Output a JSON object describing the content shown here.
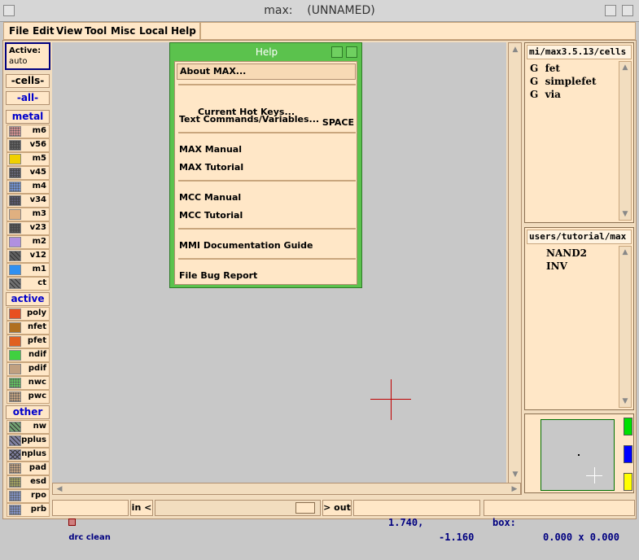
{
  "window": {
    "title": "max:    (UNNAMED)"
  },
  "menubar": {
    "items": [
      "File",
      "Edit",
      "View",
      "Tool",
      "Misc",
      "Local",
      "Help"
    ]
  },
  "active": {
    "label": "Active:",
    "value": "auto"
  },
  "sidebar": {
    "cells_label": "-cells-",
    "all_label": "-all-",
    "groups": [
      {
        "name": "metal",
        "layers": [
          {
            "name": "m6",
            "color": "#d09090",
            "pattern": "dots"
          },
          {
            "name": "v56",
            "color": "#808080",
            "pattern": "grid"
          },
          {
            "name": "m5",
            "color": "#f0d000",
            "pattern": "solid"
          },
          {
            "name": "v45",
            "color": "#8888aa",
            "pattern": "grid"
          },
          {
            "name": "m4",
            "color": "#7090d0",
            "pattern": "dots"
          },
          {
            "name": "v34",
            "color": "#7070a0",
            "pattern": "grid"
          },
          {
            "name": "m3",
            "color": "#e0b080",
            "pattern": "solid"
          },
          {
            "name": "v23",
            "color": "#707070",
            "pattern": "grid"
          },
          {
            "name": "m2",
            "color": "#b090e0",
            "pattern": "solid"
          },
          {
            "name": "v12",
            "color": "#606060",
            "pattern": "diag"
          },
          {
            "name": "m1",
            "color": "#3090f0",
            "pattern": "solid"
          },
          {
            "name": "ct",
            "color": "#707070",
            "pattern": "diag"
          }
        ]
      },
      {
        "name": "active",
        "layers": [
          {
            "name": "poly",
            "color": "#e85020",
            "pattern": "solid"
          },
          {
            "name": "nfet",
            "color": "#b07020",
            "pattern": "solid"
          },
          {
            "name": "pfet",
            "color": "#e06020",
            "pattern": "solid"
          },
          {
            "name": "ndif",
            "color": "#40d040",
            "pattern": "solid"
          },
          {
            "name": "pdif",
            "color": "#c0a080",
            "pattern": "solid"
          },
          {
            "name": "nwc",
            "color": "#60c060",
            "pattern": "dots"
          },
          {
            "name": "pwc",
            "color": "#c0a080",
            "pattern": "dots"
          }
        ]
      },
      {
        "name": "other",
        "layers": [
          {
            "name": "nw",
            "color": "#70a070",
            "pattern": "diag"
          },
          {
            "name": "pplus",
            "color": "#8080a0",
            "pattern": "diag"
          },
          {
            "name": "nplus",
            "color": "#8080a0",
            "pattern": "cross"
          },
          {
            "name": "pad",
            "color": "#c0a080",
            "pattern": "dots"
          },
          {
            "name": "esd",
            "color": "#a0a060",
            "pattern": "dots"
          },
          {
            "name": "rpo",
            "color": "#8090c0",
            "pattern": "dots"
          },
          {
            "name": "prb",
            "color": "#8090c0",
            "pattern": "dots"
          }
        ]
      }
    ]
  },
  "help_menu": {
    "title": "Help",
    "items": [
      {
        "label": "About MAX...",
        "shortcut": ""
      },
      {
        "label": "Current Hot Keys...",
        "shortcut": "SPACE"
      },
      {
        "label": "Text Commands/Variables...",
        "shortcut": ""
      },
      {
        "label": "MAX Manual",
        "shortcut": ""
      },
      {
        "label": "MAX Tutorial",
        "shortcut": ""
      },
      {
        "label": "MCC Manual",
        "shortcut": ""
      },
      {
        "label": "MCC Tutorial",
        "shortcut": ""
      },
      {
        "label": "MMI Documentation Guide",
        "shortcut": ""
      },
      {
        "label": "File Bug Report",
        "shortcut": ""
      }
    ]
  },
  "library_panel": {
    "path": "mi/max3.5.13/cells",
    "items": [
      {
        "type": "G",
        "name": "fet"
      },
      {
        "type": "G",
        "name": "simplefet"
      },
      {
        "type": "G",
        "name": "via"
      }
    ]
  },
  "user_panel": {
    "path": "users/tutorial/max",
    "items": [
      "NAND2",
      "INV"
    ]
  },
  "minimap": {
    "indicators": [
      "#00e000",
      "#0000ff",
      "#ffff00"
    ]
  },
  "status": {
    "drc": "drc clean",
    "zoom_in": "in <",
    "zoom_out": "> out",
    "coord_x": "1.740,",
    "coord_y": "-1.160",
    "box_label": "box:",
    "box_value": "0.000 x 0.000"
  }
}
